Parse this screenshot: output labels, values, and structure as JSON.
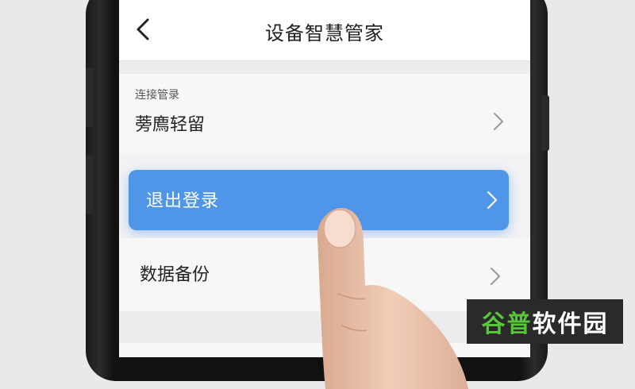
{
  "header": {
    "title": "设备智慧管家",
    "back_icon": "chevron-left-icon"
  },
  "account": {
    "section_label": "连接管录",
    "value": "蒡廌轻留"
  },
  "logout_button": {
    "label": "退出登录",
    "color": "#4f95e8"
  },
  "backup_item": {
    "label": "数据备份"
  },
  "watermark": {
    "part1": "谷普",
    "part2": "软件园",
    "color_accent": "#59c63a"
  }
}
